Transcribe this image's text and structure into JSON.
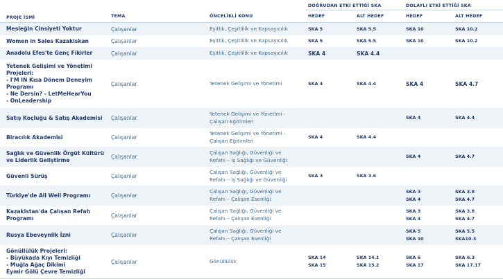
{
  "headers": {
    "proje": "PROJE İSMİ",
    "tema": "TEMA",
    "konu": "ÖNCELİKLİ KONU",
    "direct_group": "DOĞRUDAN ETKİ ETTİĞİ SKA",
    "indirect_group": "DOLAYLI ETKİ ETTİĞİ SKA",
    "d_hedef": "HEDEF",
    "d_alt": "ALT HEDEF",
    "i_hedef": "HEDEF",
    "i_alt": "ALT HEDEF"
  },
  "rows": [
    {
      "name": "Mesleğin Cinsiyeti Yoktur",
      "tema": "Çalışanlar",
      "konu": "Eşitlik, Çeşitlilik ve Kapsayıcılık",
      "d_hedef": "SKA 5",
      "d_alt": "SKA 5.5",
      "i_hedef": "SKA 10",
      "i_alt": "SKA 10.2"
    },
    {
      "name": "Women in Sales Kazakiskan",
      "tema": "Çalışanlar",
      "konu": "Eşitlik, Çeşitlilik ve Kapsayıcılık",
      "d_hedef": "SKA 5",
      "d_alt": "SKA 5.5",
      "i_hedef": "SKA 10",
      "i_alt": "SKA 10.2"
    },
    {
      "name": "Anadolu Efes'te Genç Fikirler",
      "tema": "Çalışanlar",
      "konu": "Eşitlik, Çeşitlilik ve Kapsayıcılık",
      "d_hedef": "SKA 4",
      "d_alt": "SKA 4.4",
      "i_hedef": "",
      "i_alt": ""
    },
    {
      "name": "Yetenek Gelişimi ve Yönetimi\nProjeleri:\n- I'M IN Kısa Dönem Deneyim\nProgramı\n- Ne Dersin? - LetMeHearYou\n- OnLeadership",
      "tema": "Çalışanlar",
      "konu": "Yetenek Gelişimi ve Yönetimi",
      "d_hedef": "SKA 4",
      "d_alt": "SKA 4.4",
      "i_hedef": "SKA 4",
      "i_alt": "SKA 4.7"
    },
    {
      "name": "Satış Koçluğu & Satış Akademisi",
      "tema": "Çalışanlar",
      "konu": "Yetenek Gelişimi ve Yönetimi -\nÇalışan Eğitimleri",
      "d_hedef": "",
      "d_alt": "",
      "i_hedef": "SKA 4",
      "i_alt": "SKA 4.4"
    },
    {
      "name": "Biracılık Akademisi",
      "tema": "Çalışanlar",
      "konu": "Yetenek Gelişimi ve Yönetimi -\nÇalışan Eğitimleri",
      "d_hedef": "SKA 4",
      "d_alt": "SKA 4.4",
      "i_hedef": "",
      "i_alt": ""
    },
    {
      "name": "Sağlık ve Güvenlik Örgüt Kültürü\nve Liderlik Geliştirme",
      "tema": "Çalışanlar",
      "konu": "Çalışan Sağlığı, Güvenliği ve\nRefahı – İş Sağlığı ve Güvenliği",
      "d_hedef": "",
      "d_alt": "",
      "i_hedef": "SKA 4",
      "i_alt": "SKA 4.7"
    },
    {
      "name": "Güvenli Sürüş",
      "tema": "Çalışanlar",
      "konu": "Çalışan Sağlığı, Güvenliği ve\nRefahı – İş Sağlığı ve Güvenliği",
      "d_hedef": "SKA 3",
      "d_alt": "SKA 3.6",
      "i_hedef": "",
      "i_alt": ""
    },
    {
      "name": "Türkiye'de All Well Programı",
      "tema": "Çalışanlar",
      "konu": "Çalışan Sağlığı, Güvenliği ve\nRefahı – Çalışan Esenliği",
      "d_hedef": "",
      "d_alt": "",
      "i_hedef": "SKA 3\nSKA 4",
      "i_alt": "SKA 3.8\nSKA 4.7"
    },
    {
      "name": "Kazakistan'da Çalışan Refah\nProgramı",
      "tema": "Çalışanlar",
      "konu": "Çalışan Sağlığı, Güvenliği ve\nRefahı – Çalışan Esenliği",
      "d_hedef": "",
      "d_alt": "",
      "i_hedef": "SKA 3\nSKA 4",
      "i_alt": "SKA 3.8\nSKA 4.7"
    },
    {
      "name": "Rusya Ebeveynlik İzni",
      "tema": "Çalışanlar",
      "konu": "Çalışan Sağlığı, Güvenliği ve\nRefahı – Çalışan Esenliği",
      "d_hedef": "",
      "d_alt": "",
      "i_hedef": "SKA 5\nSKA 10",
      "i_alt": "SKA 5.5\nSKA10.3"
    },
    {
      "name": "Gönüllülük Projeleri:\n- Büyükada Kıyı Temizliği\n- Muğla Ağaç Dikimi\nEymir Gölü Çevre Temizliği",
      "tema": "Çalışanlar",
      "konu": "Gönüllülük",
      "d_hedef": "SKA 14\nSKA 15",
      "d_alt": "SKA 14.1\nSKA 15.2",
      "i_hedef": "SKA 6\nSKA 17",
      "i_alt": "SKA 6.3\nSKA 17.17"
    }
  ]
}
